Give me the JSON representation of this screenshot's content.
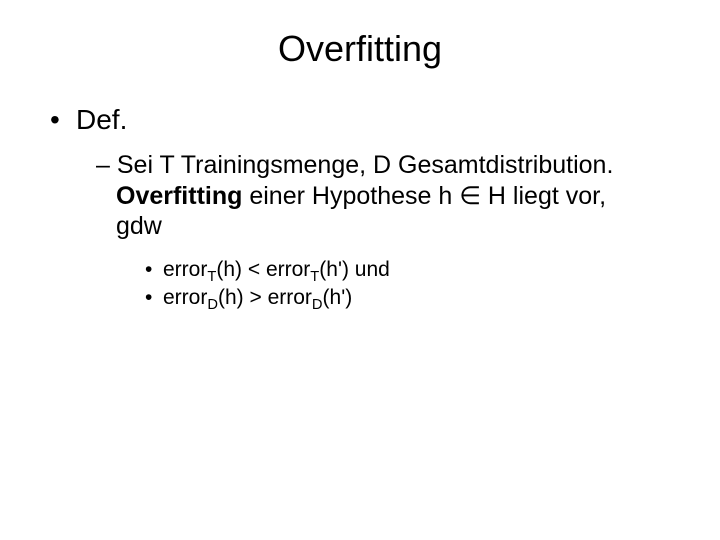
{
  "title": "Overfitting",
  "level1": {
    "bullet": "•",
    "text": "Def."
  },
  "level2": {
    "dash": "–",
    "part1": "Sei T Trainingsmenge, D Gesamtdistribution.",
    "boldword": "Overfitting",
    "part2a": " einer Hypothese h ",
    "elem": "∈",
    "part2b": " H liegt vor,",
    "part3": "gdw"
  },
  "level3a": {
    "dot": "•",
    "e": "error",
    "subT": "T",
    "lp": "(h) < ",
    "e2": "error",
    "subT2": "T",
    "rp": "(h') und"
  },
  "level3b": {
    "dot": "•",
    "e": "error",
    "subD": "D",
    "lp": "(h) > ",
    "e2": "error",
    "subD2": "D",
    "rp": "(h')"
  }
}
